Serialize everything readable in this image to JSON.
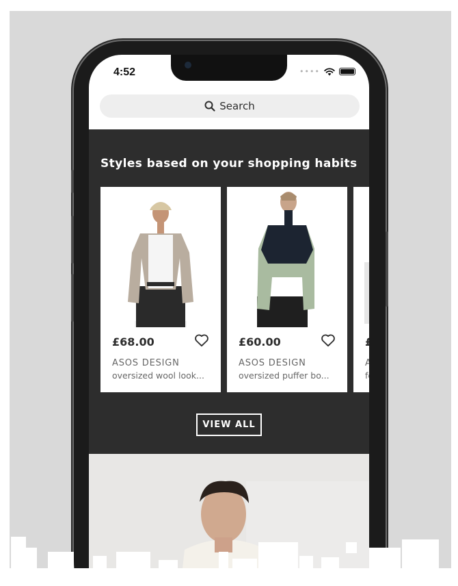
{
  "status_bar": {
    "time": "4:52",
    "signal_dots": "••••"
  },
  "search": {
    "label": "Search",
    "icon": "search-icon"
  },
  "recommendations": {
    "title": "Styles based on your shopping habits",
    "products": [
      {
        "price": "£68.00",
        "brand": "ASOS DESIGN",
        "description": "oversized wool look...",
        "icon": "heart-outline-icon"
      },
      {
        "price": "£60.00",
        "brand": "ASOS DESIGN",
        "description": "oversized puffer bo...",
        "icon": "heart-outline-icon"
      },
      {
        "price": "£",
        "brand": "A",
        "description": "fo"
      }
    ],
    "view_all_label": "VIEW ALL"
  },
  "colors": {
    "section_background": "#2d2d2d",
    "card_background": "#ffffff",
    "search_background": "#eeeeee",
    "outer_background": "#d9d9d9"
  }
}
